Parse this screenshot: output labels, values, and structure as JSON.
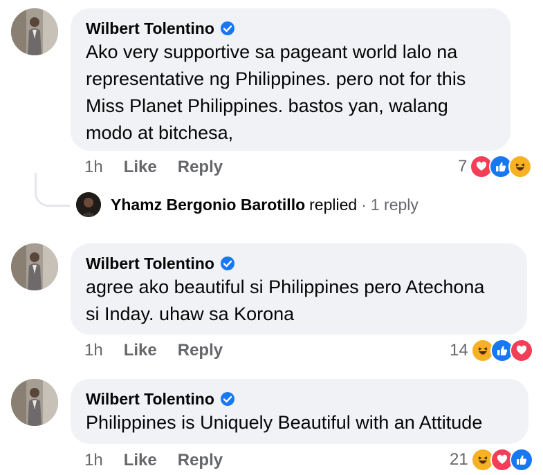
{
  "comments": [
    {
      "author": "Wilbert Tolentino",
      "verified": true,
      "text": "Ako very supportive sa pageant world lalo na\nrepresentative ng Philippines. pero not for this\nMiss Planet Philippines. bastos yan, walang\nmodo at bitchesa,",
      "time": "1h",
      "like_label": "Like",
      "reply_label": "Reply",
      "reaction_count": "7",
      "reactions": [
        "love-reaction-icon",
        "like-reaction-icon",
        "haha-reaction-icon"
      ]
    },
    {
      "author": "Wilbert Tolentino",
      "verified": true,
      "text": "agree ako beautiful si Philippines pero Atechona\nsi Inday. uhaw sa Korona",
      "time": "1h",
      "like_label": "Like",
      "reply_label": "Reply",
      "reaction_count": "14",
      "reactions": [
        "haha-reaction-icon",
        "like-reaction-icon",
        "love-reaction-icon"
      ]
    },
    {
      "author": "Wilbert Tolentino",
      "verified": true,
      "text": "Philippines is Uniquely Beautiful with an Attitude",
      "time": "1h",
      "like_label": "Like",
      "reply_label": "Reply",
      "reaction_count": "21",
      "reactions": [
        "haha-reaction-icon",
        "love-reaction-icon",
        "like-reaction-icon"
      ]
    }
  ],
  "reply_summary": {
    "replier": "Yhamz Bergonio Barotillo",
    "replied_text": "replied",
    "separator": "·",
    "count_text": "1 reply"
  },
  "colors": {
    "bubble_bg": "#f0f2f5",
    "secondary_text": "#65676b",
    "verified_blue": "#1877f2",
    "love_red": "#f33e58",
    "haha_yellow": "#f7b125"
  }
}
